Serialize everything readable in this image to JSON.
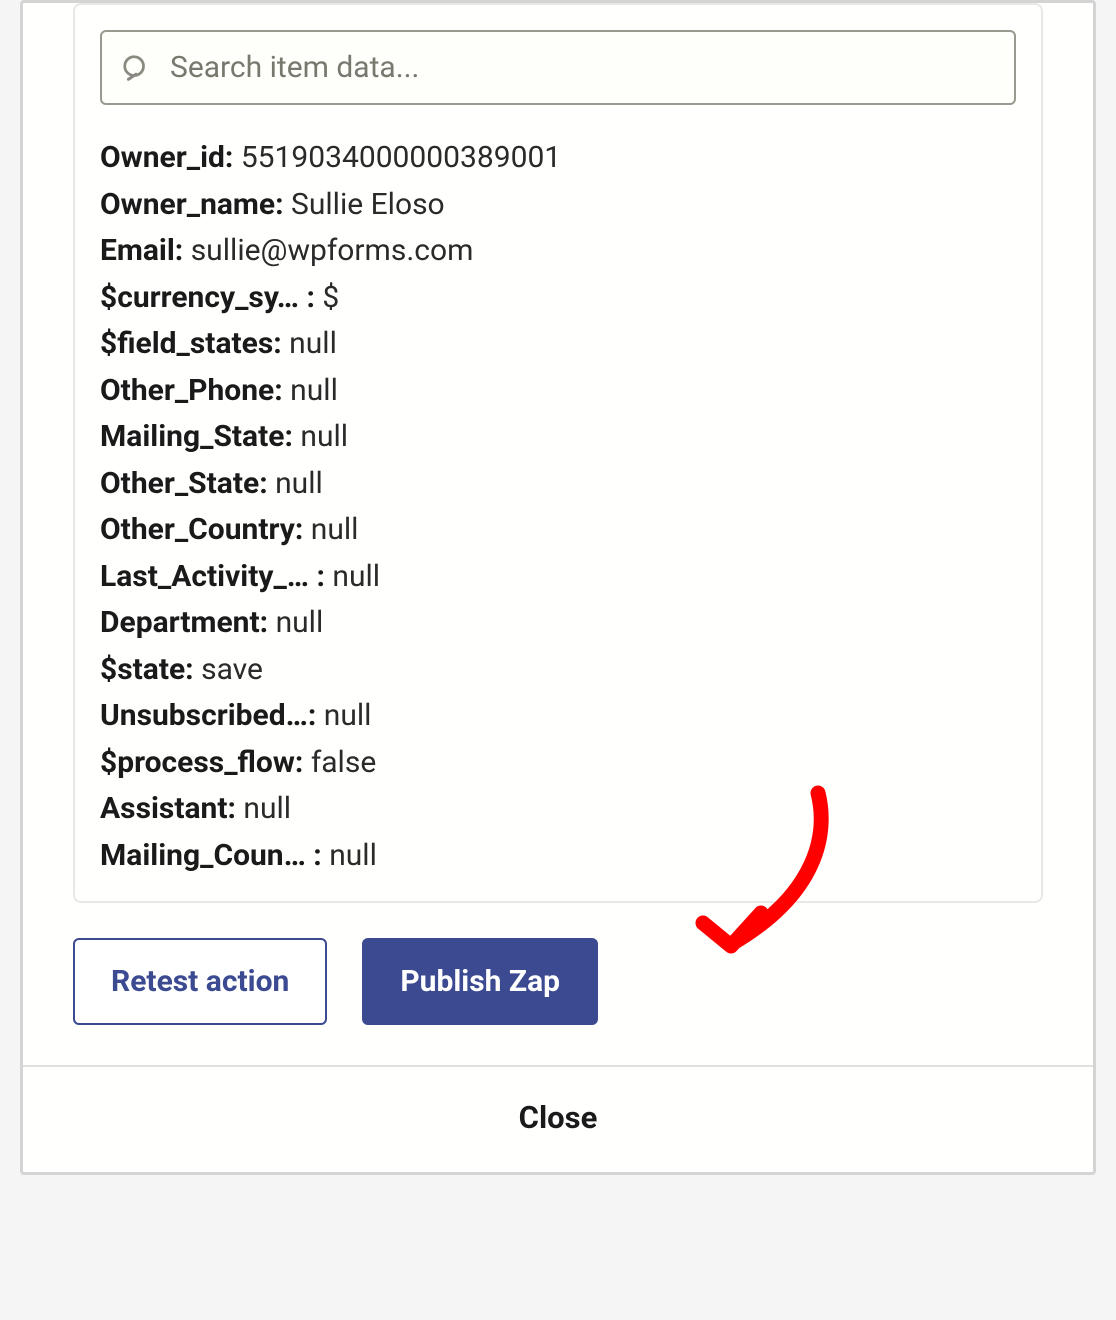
{
  "search": {
    "placeholder": "Search item data..."
  },
  "data_rows": [
    {
      "key": "Owner_id:",
      "value": "5519034000000389001"
    },
    {
      "key": "Owner_name:",
      "value": "Sullie Eloso"
    },
    {
      "key": "Email:",
      "value": "sullie@wpforms.com"
    },
    {
      "key": "$currency_sy… :",
      "value": "$"
    },
    {
      "key": "$field_states:",
      "value": "null"
    },
    {
      "key": "Other_Phone:",
      "value": "null"
    },
    {
      "key": "Mailing_State:",
      "value": "null"
    },
    {
      "key": "Other_State:",
      "value": "null"
    },
    {
      "key": "Other_Country:",
      "value": "null"
    },
    {
      "key": "Last_Activity_… :",
      "value": "null"
    },
    {
      "key": "Department:",
      "value": "null"
    },
    {
      "key": "$state:",
      "value": "save"
    },
    {
      "key": "Unsubscribed…:",
      "value": "null"
    },
    {
      "key": "$process_flow:",
      "value": "false"
    },
    {
      "key": "Assistant:",
      "value": "null"
    },
    {
      "key": "Mailing_Coun… :",
      "value": "null"
    }
  ],
  "buttons": {
    "retest": "Retest action",
    "publish": "Publish Zap",
    "close": "Close"
  },
  "annotation": {
    "arrow_color": "#FF0000"
  }
}
